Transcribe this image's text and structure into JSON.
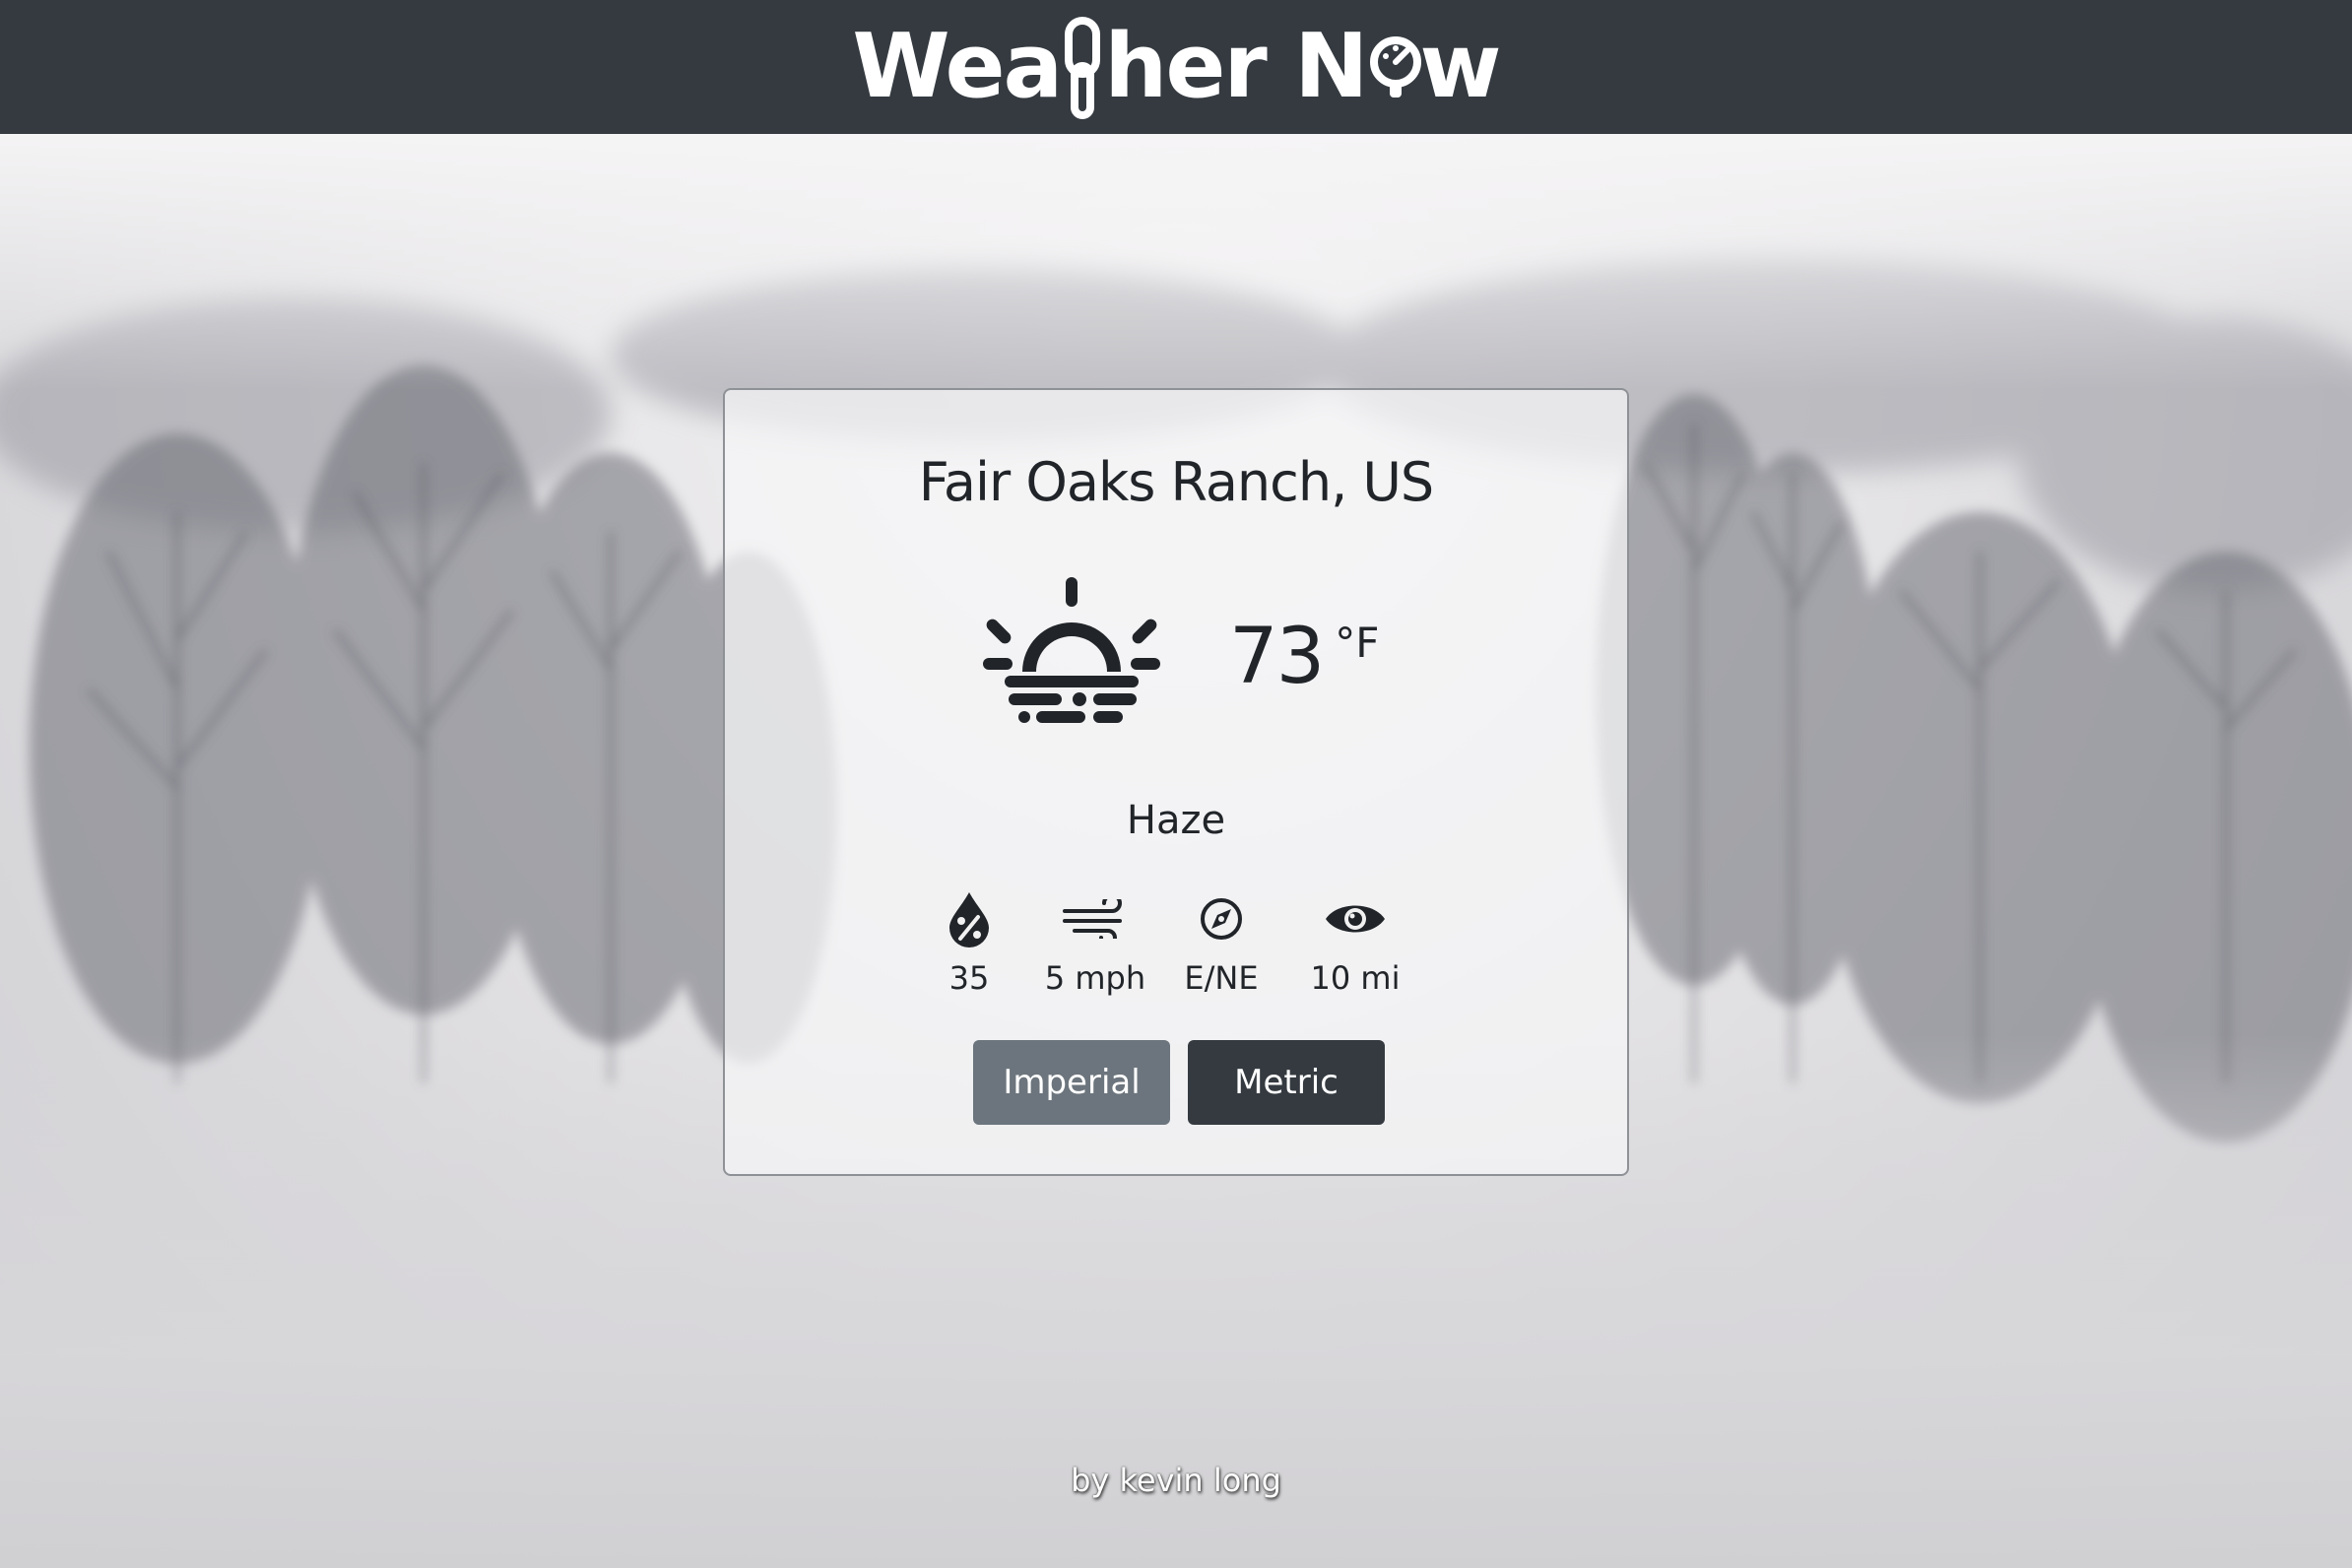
{
  "header": {
    "logo_text_a": "Wea",
    "logo_text_b": "her N",
    "logo_text_c": "w"
  },
  "card": {
    "city": "Fair Oaks Ranch, US",
    "temperature": "73",
    "temperature_unit": "°F",
    "condition": "Haze",
    "condition_icon": "haze-icon",
    "stats": {
      "humidity": {
        "icon": "humidity-icon",
        "value": "35"
      },
      "wind_speed": {
        "icon": "wind-icon",
        "value": "5 mph"
      },
      "wind_direction": {
        "icon": "compass-icon",
        "value": "E/NE"
      },
      "visibility": {
        "icon": "eye-icon",
        "value": "10 mi"
      }
    },
    "buttons": {
      "imperial": "Imperial",
      "metric": "Metric"
    }
  },
  "footer": {
    "credit": "by kevin long"
  },
  "colors": {
    "header_bg": "#343a40",
    "imperial_button": "#6c757d",
    "metric_button": "#343a40",
    "text": "#212529"
  }
}
